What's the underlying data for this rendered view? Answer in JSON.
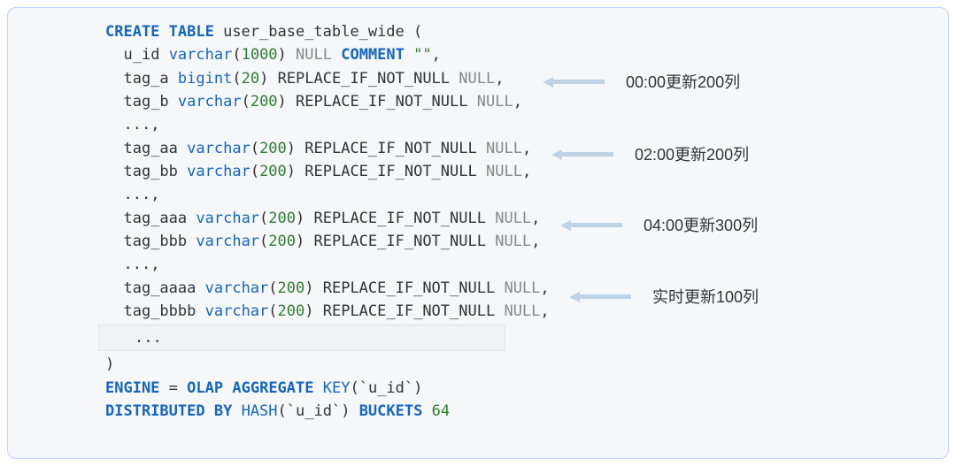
{
  "code": {
    "create_table": "CREATE TABLE",
    "table_name": "user_base_table_wide",
    "open_paren": "(",
    "u_id_name": "u_id",
    "varchar": "varchar",
    "bigint": "bigint",
    "num_1000": "1000",
    "num_200": "200",
    "num_20": "20",
    "null_kw": "NULL",
    "comment_kw": "COMMENT",
    "empty_str": "\"\"",
    "replace_if": "REPLACE_IF_NOT_NULL",
    "tag_a": "tag_a",
    "tag_b": "tag_b",
    "tag_aa": "tag_aa",
    "tag_bb": "tag_bb",
    "tag_aaa": "tag_aaa",
    "tag_bbb": "tag_bbb",
    "tag_aaaa": "tag_aaaa",
    "tag_bbbb": "tag_bbbb",
    "dots": "...,",
    "dots2": "...",
    "close_paren": ")",
    "engine_line_1": "ENGINE",
    "equals": "=",
    "olap": "OLAP",
    "aggregate": "AGGREGATE",
    "key_kw": "KEY",
    "u_id_quoted": "`u_id`",
    "distributed": "DISTRIBUTED",
    "by_kw": "BY",
    "hash": "HASH",
    "buckets": "BUCKETS",
    "num_64": "64",
    "comma": ","
  },
  "annotations": {
    "a1": "00:00更新200列",
    "a2": "02:00更新200列",
    "a3": "04:00更新300列",
    "a4": "实时更新100列"
  }
}
